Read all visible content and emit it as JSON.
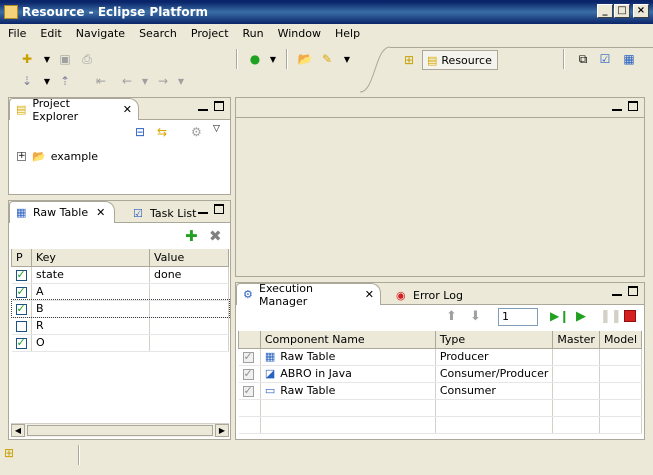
{
  "window": {
    "title": "Resource - Eclipse Platform",
    "min_label": "_",
    "max_label": "□",
    "close_label": "×"
  },
  "menu": [
    "File",
    "Edit",
    "Navigate",
    "Search",
    "Project",
    "Run",
    "Window",
    "Help"
  ],
  "perspective": {
    "label": "Resource"
  },
  "project_explorer": {
    "tab_label": "Project Explorer",
    "tree": [
      {
        "label": "example",
        "expander": "+"
      }
    ]
  },
  "raw_table": {
    "tab_label": "Raw Table",
    "other_tab_label": "Task List",
    "columns": [
      "P",
      "Key",
      "Value"
    ],
    "rows": [
      {
        "checked": true,
        "key": "state",
        "value": "done"
      },
      {
        "checked": true,
        "key": "A",
        "value": ""
      },
      {
        "checked": true,
        "key": "B",
        "value": ""
      },
      {
        "checked": false,
        "key": "R",
        "value": ""
      },
      {
        "checked": true,
        "key": "O",
        "value": ""
      }
    ]
  },
  "execution_manager": {
    "tab_label": "Execution Manager",
    "other_tab_label": "Error Log",
    "step_value": "1",
    "columns": [
      "Component Name",
      "Type",
      "Master",
      "Model"
    ],
    "rows": [
      {
        "checked": true,
        "name": "Raw Table",
        "type": "Producer"
      },
      {
        "checked": true,
        "name": "ABRO in Java",
        "type": "Consumer/Producer"
      },
      {
        "checked": true,
        "name": "Raw Table",
        "type": "Consumer"
      }
    ]
  },
  "colors": {
    "title_bar": "#0a246a",
    "panel_border": "#aca899",
    "chrome": "#ece9d8",
    "accent_green": "#21a121",
    "stop_red": "#d42020"
  }
}
